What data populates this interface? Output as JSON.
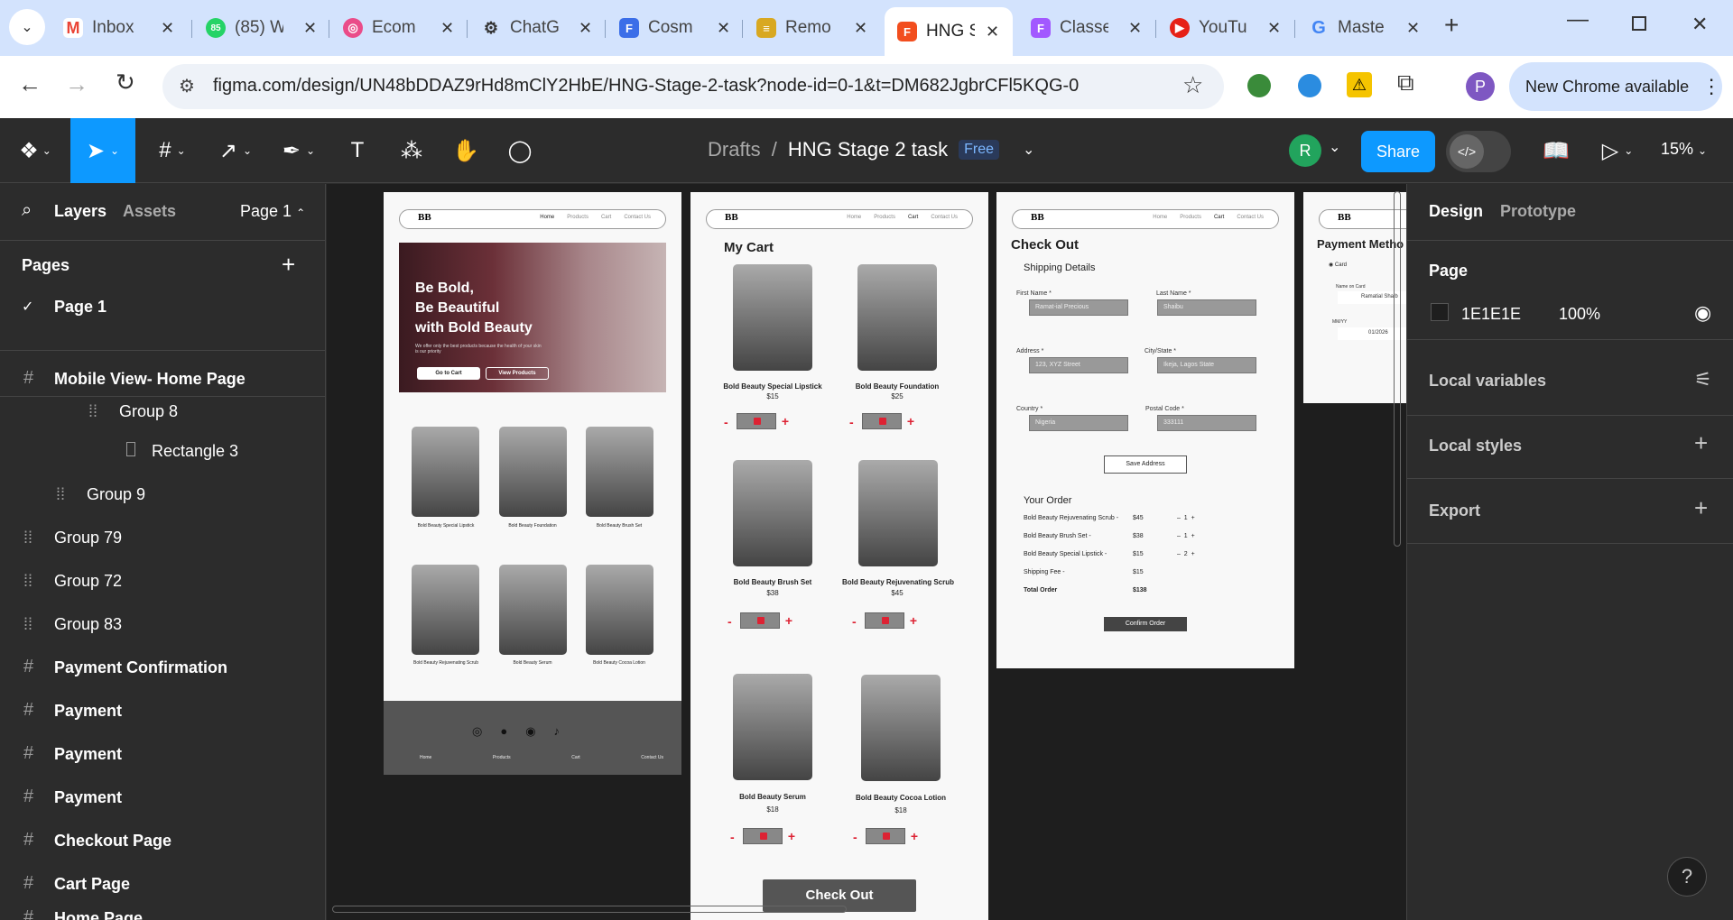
{
  "browser": {
    "tabs": [
      {
        "label": "Inbox"
      },
      {
        "label": "(85) W"
      },
      {
        "label": "Ecom"
      },
      {
        "label": "ChatG"
      },
      {
        "label": "Cosm"
      },
      {
        "label": "Remo"
      },
      {
        "label": "HNG S"
      },
      {
        "label": "Classe"
      },
      {
        "label": "YouTu"
      },
      {
        "label": "Maste"
      }
    ],
    "whatsapp_badge": "85",
    "url": "figma.com/design/UN48bDDAZ9rHd8mClY2HbE/HNG-Stage-2-task?node-id=0-1&t=DM682JgbrCFl5KQG-0",
    "profile_initial": "P",
    "new_chrome": "New Chrome available"
  },
  "figma": {
    "breadcrumb_root": "Drafts",
    "breadcrumb_sep": "/",
    "file_name": "HNG Stage 2 task",
    "plan_badge": "Free",
    "user_initial": "R",
    "share_label": "Share",
    "zoom": "15%",
    "left": {
      "tab_layers": "Layers",
      "tab_assets": "Assets",
      "page_selector": "Page 1",
      "pages_heading": "Pages",
      "current_page": "Page 1",
      "layers": [
        {
          "label": "Mobile View- Home Page",
          "bold": true
        },
        {
          "label": "Group 8"
        },
        {
          "label": "Rectangle 3"
        },
        {
          "label": "Group 9"
        },
        {
          "label": "Group 79"
        },
        {
          "label": "Group 72"
        },
        {
          "label": "Group 83"
        },
        {
          "label": "Payment Confirmation",
          "bold": true
        },
        {
          "label": "Payment",
          "bold": true
        },
        {
          "label": "Payment",
          "bold": true
        },
        {
          "label": "Payment",
          "bold": true
        },
        {
          "label": "Checkout Page",
          "bold": true
        },
        {
          "label": "Cart Page",
          "bold": true
        },
        {
          "label": "Home Page",
          "bold": true
        }
      ]
    },
    "right": {
      "tab_design": "Design",
      "tab_prototype": "Prototype",
      "page_heading": "Page",
      "page_color": "1E1E1E",
      "page_opacity": "100%",
      "local_variables": "Local variables",
      "local_styles": "Local styles",
      "export": "Export",
      "help": "?"
    }
  },
  "canvas": {
    "nav_logo": "BB",
    "nav_links": [
      "Home",
      "Products",
      "Cart",
      "Contact Us"
    ],
    "home": {
      "hero_line1": "Be Bold,",
      "hero_line2": "Be Beautiful",
      "hero_line3": "with Bold Beauty",
      "hero_sub": "We offer only the best products because the health of your skin is our priority",
      "btn_cart": "Go to Cart",
      "btn_products": "View Products",
      "products": [
        "Bold Beauty Special Lipstick",
        "Bold  Beauty Foundation",
        "Bold Beauty Brush Set",
        "Bold Beauty Rejuvenating Scrub",
        "Bold Beauty Serum",
        "Bold Beauty Cocoa Lotion"
      ],
      "footer_links": [
        "Home",
        "Products",
        "Cart",
        "Contact Us"
      ]
    },
    "cart": {
      "title": "My Cart",
      "items": [
        {
          "name": "Bold Beauty Special Lipstick",
          "price": "$15"
        },
        {
          "name": "Bold Beauty Foundation",
          "price": "$25"
        },
        {
          "name": "Bold Beauty Brush Set",
          "price": "$38"
        },
        {
          "name": "Bold Beauty Rejuvenating Scrub",
          "price": "$45"
        },
        {
          "name": "Bold Beauty Serum",
          "price": "$18"
        },
        {
          "name": "Bold Beauty Cocoa Lotion",
          "price": "$18"
        }
      ],
      "checkout_label": "Check Out"
    },
    "checkout": {
      "title": "Check Out",
      "shipping": "Shipping Details",
      "first_name_label": "First Name  *",
      "first_name": "Ramat-ial Precious",
      "last_name_label": "Last Name  *",
      "last_name": "Shaibu",
      "address_label": "Address       *",
      "address": "123, XYZ Street",
      "city_label": "City/State  *",
      "city": "Ikeja, Lagos State",
      "country_label": "Country     *",
      "country": "Nigeria",
      "postal_label": "Postal Code  *",
      "postal": "333111",
      "save_address": "Save Address",
      "your_order": "Your Order",
      "order_lines": [
        {
          "name": "Bold Beauty Rejuvenating Scrub -",
          "price": "$45",
          "qty": "1"
        },
        {
          "name": "Bold Beauty Brush Set -",
          "price": "$38",
          "qty": "1"
        },
        {
          "name": "Bold Beauty Special Lipstick -",
          "price": "$15",
          "qty": "2"
        }
      ],
      "shipping_fee_label": "Shipping Fee -",
      "shipping_fee": "$15",
      "total_label": "Total Order",
      "total": "$138",
      "confirm": "Confirm Order"
    },
    "payment": {
      "title": "Payment Metho",
      "card": "Card",
      "name_label": "Name on Card",
      "name": "Ramatial Shaib",
      "date_label": "MM/YY",
      "date": "01/2026"
    }
  }
}
